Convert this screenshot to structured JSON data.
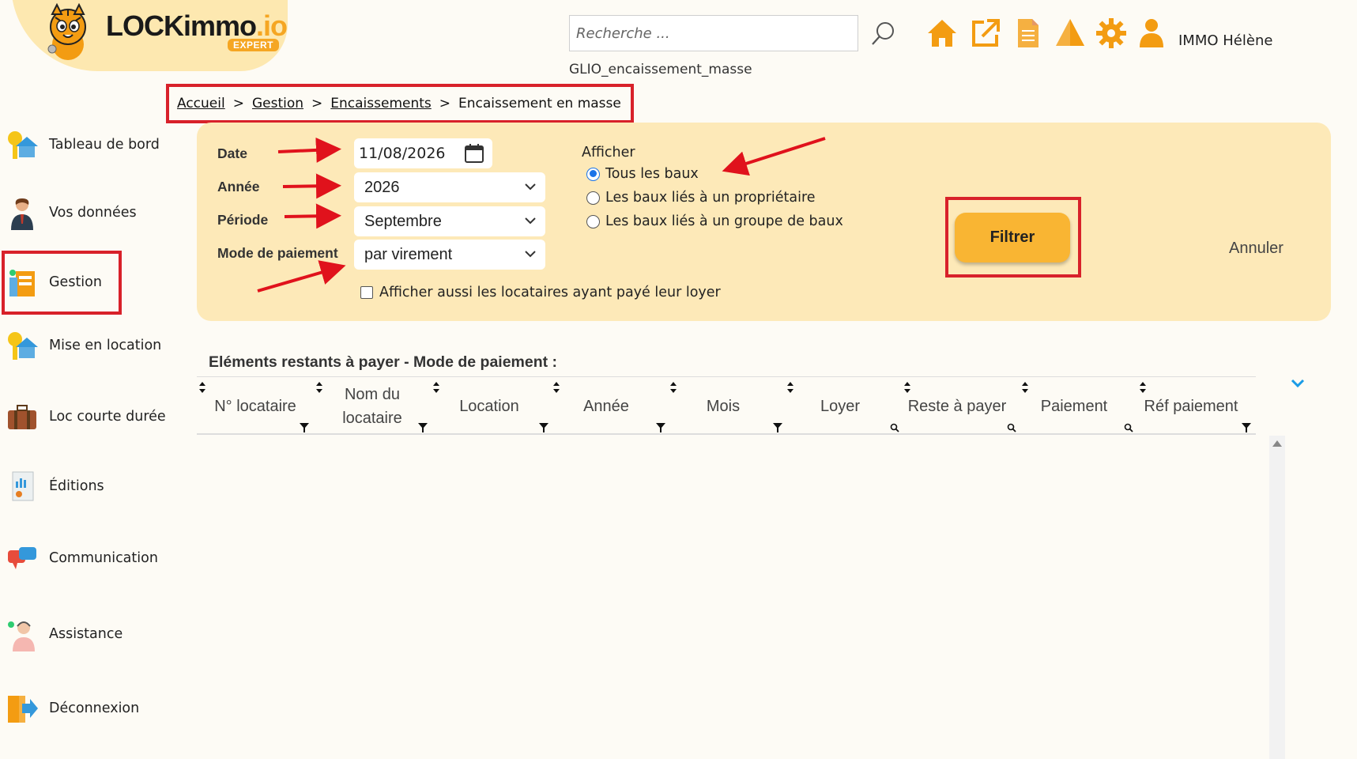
{
  "logo": {
    "name": "LOCKimmo",
    "suffix": ".io",
    "badge": "EXPERT"
  },
  "header": {
    "search_placeholder": "Recherche ...",
    "user_name": "IMMO Hélène",
    "page_code": "GLIO_encaissement_masse",
    "icons": [
      "search-icon",
      "home-icon",
      "external-link-icon",
      "document-icon",
      "alert-icon",
      "gear-icon",
      "user-icon"
    ],
    "accent_color": "#f5a623"
  },
  "breadcrumb": {
    "items": [
      "Accueil",
      "Gestion",
      "Encaissements"
    ],
    "separator": ">",
    "current": "Encaissement en masse"
  },
  "sidebar": {
    "items": [
      {
        "label": "Tableau de bord",
        "icon": "dashboard-key-house-icon"
      },
      {
        "label": "Vos données",
        "icon": "person-icon"
      },
      {
        "label": "Gestion",
        "icon": "management-icon",
        "active": true
      },
      {
        "label": "Mise en location",
        "icon": "rental-key-house-icon"
      },
      {
        "label": "Loc courte durée",
        "icon": "suitcase-icon"
      },
      {
        "label": "Éditions",
        "icon": "report-icon"
      },
      {
        "label": "Communication",
        "icon": "chat-bubbles-icon"
      },
      {
        "label": "Assistance",
        "icon": "support-agent-icon"
      },
      {
        "label": "Déconnexion",
        "icon": "logout-icon"
      }
    ]
  },
  "filters": {
    "date_label": "Date",
    "date_value": "11/08/2026",
    "annee_label": "Année",
    "annee_value": "2026",
    "periode_label": "Période",
    "periode_value": "Septembre",
    "mode_label": "Mode de paiement",
    "mode_value": "par virement",
    "checkbox_label": "Afficher aussi les locataires ayant payé leur loyer",
    "checkbox_checked": false,
    "afficher_label": "Afficher",
    "radio_options": [
      "Tous les baux",
      "Les baux liés à un propriétaire",
      "Les baux liés à un groupe de baux"
    ],
    "radio_selected": "Tous les baux",
    "filter_button": "Filtrer",
    "cancel_button": "Annuler",
    "button_color": "#f9b533",
    "panel_color": "#fde9b8",
    "annotation_color": "#d8212a"
  },
  "table": {
    "title": "Eléments restants à payer - Mode de paiement :",
    "columns": [
      {
        "label": "N° locataire",
        "filter": "funnel"
      },
      {
        "label": "Nom du locataire",
        "filter": "funnel"
      },
      {
        "label": "Location",
        "filter": "funnel"
      },
      {
        "label": "Année",
        "filter": "funnel"
      },
      {
        "label": "Mois",
        "filter": "funnel"
      },
      {
        "label": "Loyer",
        "filter": "search"
      },
      {
        "label": "Reste à payer",
        "filter": "search"
      },
      {
        "label": "Paiement",
        "filter": "search"
      },
      {
        "label": "Réf paiement",
        "filter": "funnel"
      }
    ],
    "rows": []
  }
}
